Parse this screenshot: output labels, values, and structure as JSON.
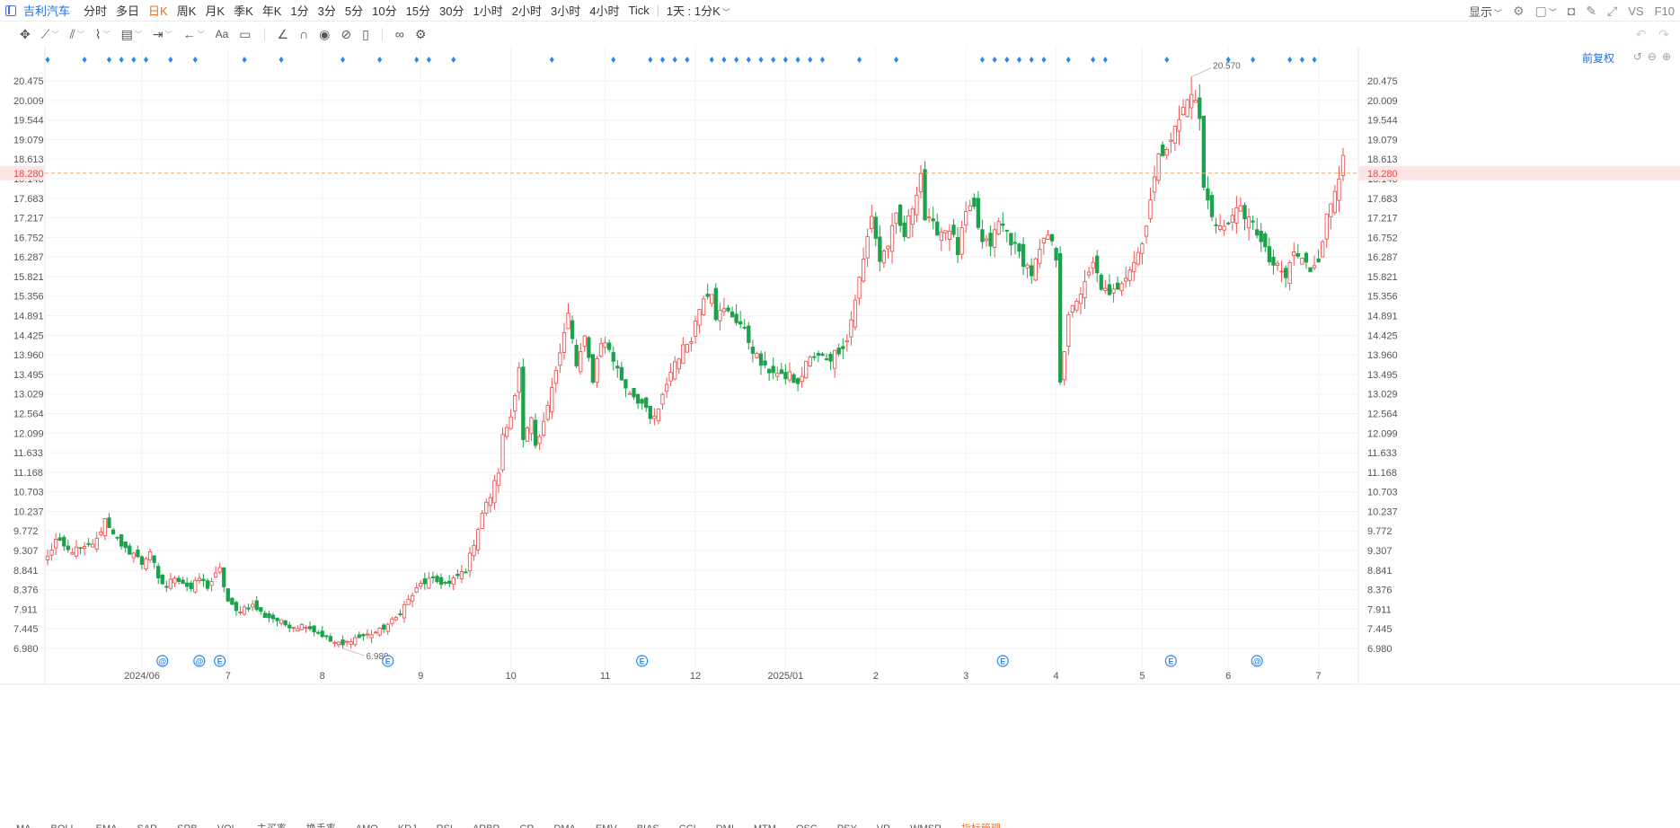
{
  "topbar": {
    "stock_name": "吉利汽车",
    "periods": [
      "分时",
      "多日",
      "日K",
      "周K",
      "月K",
      "季K",
      "年K",
      "1分",
      "3分",
      "5分",
      "10分",
      "15分",
      "30分",
      "1小时",
      "2小时",
      "3小时",
      "4小时",
      "Tick"
    ],
    "active_period": "日K",
    "interval_dropdown": "1天 : 1分K",
    "display_label": "显示",
    "vs_label": "VS",
    "f10_label": "F10"
  },
  "chart_header": {
    "fuquan_label": "前复权"
  },
  "colors": {
    "up": "#f05454",
    "down": "#1aa34a",
    "current_price_line": "#f6a86a",
    "event_marker": "#2b86f0",
    "accent": "#1e6fe8",
    "active_tab": "#f0701e"
  },
  "indicator_strip": {
    "items": [
      "MA",
      "BOLL",
      "EMA",
      "SAR",
      "SRB",
      "VOL",
      "主买率",
      "换手率",
      "AMO",
      "KDJ",
      "RSI",
      "ARBR",
      "CR",
      "DMA",
      "EMV",
      "BIAS",
      "CCI",
      "DMI",
      "MTM",
      "OSC",
      "PSY",
      "VR",
      "WMSR",
      "指标管理"
    ]
  },
  "chart_data": {
    "type": "candlestick",
    "title": "",
    "yaxis_ticks": [
      "20.475",
      "20.009",
      "19.544",
      "19.079",
      "18.613",
      "18.148",
      "17.683",
      "17.217",
      "16.752",
      "16.287",
      "15.821",
      "15.356",
      "14.891",
      "14.425",
      "13.960",
      "13.495",
      "13.029",
      "12.564",
      "12.099",
      "11.633",
      "11.168",
      "10.703",
      "10.237",
      "9.772",
      "9.307",
      "8.841",
      "8.376",
      "7.911",
      "7.445",
      "6.980"
    ],
    "ylim": [
      6.98,
      20.475
    ],
    "current_price": 18.28,
    "current_price_label": "18.280",
    "max_label": "20.570",
    "min_label": "6.980",
    "x_labels": [
      "2024/06",
      "7",
      "8",
      "9",
      "10",
      "11",
      "12",
      "2025/01",
      "2",
      "3",
      "4",
      "5",
      "6",
      "7"
    ],
    "x_label_index": [
      23,
      44,
      67,
      91,
      113,
      136,
      158,
      180,
      202,
      224,
      246,
      267,
      288,
      310
    ],
    "max_index": 279,
    "min_index": 72,
    "events": [
      {
        "index": 28,
        "mark": "@"
      },
      {
        "index": 37,
        "mark": "@"
      },
      {
        "index": 42,
        "mark": "E"
      },
      {
        "index": 83,
        "mark": "E"
      },
      {
        "index": 145,
        "mark": "E"
      },
      {
        "index": 233,
        "mark": "E"
      },
      {
        "index": 274,
        "mark": "E"
      },
      {
        "index": 295,
        "mark": "@"
      }
    ],
    "anchors": [
      [
        0,
        9.15
      ],
      [
        2,
        9.55
      ],
      [
        5,
        9.3
      ],
      [
        9,
        9.35
      ],
      [
        12,
        9.55
      ],
      [
        14,
        10.05
      ],
      [
        16,
        9.75
      ],
      [
        18,
        9.35
      ],
      [
        21,
        9.25
      ],
      [
        23,
        9.0
      ],
      [
        25,
        9.3
      ],
      [
        27,
        8.6
      ],
      [
        29,
        8.45
      ],
      [
        31,
        8.7
      ],
      [
        33,
        8.55
      ],
      [
        35,
        8.4
      ],
      [
        37,
        8.65
      ],
      [
        39,
        8.45
      ],
      [
        42,
        8.85
      ],
      [
        44,
        8.1
      ],
      [
        46,
        7.85
      ],
      [
        48,
        7.95
      ],
      [
        50,
        8.0
      ],
      [
        53,
        7.75
      ],
      [
        55,
        7.7
      ],
      [
        58,
        7.55
      ],
      [
        61,
        7.5
      ],
      [
        63,
        7.55
      ],
      [
        65,
        7.4
      ],
      [
        67,
        7.3
      ],
      [
        69,
        7.15
      ],
      [
        72,
        7.05
      ],
      [
        74,
        7.2
      ],
      [
        76,
        7.25
      ],
      [
        78,
        7.3
      ],
      [
        81,
        7.4
      ],
      [
        83,
        7.55
      ],
      [
        85,
        7.7
      ],
      [
        87,
        8.0
      ],
      [
        89,
        8.25
      ],
      [
        91,
        8.5
      ],
      [
        93,
        8.6
      ],
      [
        96,
        8.55
      ],
      [
        98,
        8.5
      ],
      [
        100,
        8.7
      ],
      [
        102,
        8.85
      ],
      [
        104,
        9.5
      ],
      [
        106,
        10.2
      ],
      [
        108,
        10.6
      ],
      [
        110,
        11.2
      ],
      [
        111,
        12.0
      ],
      [
        113,
        12.5
      ],
      [
        115,
        13.7
      ],
      [
        116,
        11.9
      ],
      [
        118,
        12.4
      ],
      [
        119,
        11.7
      ],
      [
        121,
        12.3
      ],
      [
        123,
        13.3
      ],
      [
        125,
        14.0
      ],
      [
        127,
        14.9
      ],
      [
        129,
        13.7
      ],
      [
        131,
        14.3
      ],
      [
        133,
        13.4
      ],
      [
        135,
        14.3
      ],
      [
        137,
        14.1
      ],
      [
        139,
        13.6
      ],
      [
        141,
        13.2
      ],
      [
        143,
        13.0
      ],
      [
        145,
        12.8
      ],
      [
        147,
        12.4
      ],
      [
        149,
        12.6
      ],
      [
        151,
        13.3
      ],
      [
        153,
        13.8
      ],
      [
        155,
        14.1
      ],
      [
        157,
        14.4
      ],
      [
        160,
        15.4
      ],
      [
        162,
        15.5
      ],
      [
        163,
        14.9
      ],
      [
        165,
        15.0
      ],
      [
        167,
        14.9
      ],
      [
        169,
        14.7
      ],
      [
        171,
        14.3
      ],
      [
        173,
        13.9
      ],
      [
        175,
        13.6
      ],
      [
        177,
        13.6
      ],
      [
        179,
        13.4
      ],
      [
        181,
        13.5
      ],
      [
        183,
        13.2
      ],
      [
        185,
        13.8
      ],
      [
        187,
        13.9
      ],
      [
        189,
        13.9
      ],
      [
        191,
        13.9
      ],
      [
        193,
        14.1
      ],
      [
        195,
        14.3
      ],
      [
        197,
        15.3
      ],
      [
        199,
        16.2
      ],
      [
        201,
        17.3
      ],
      [
        203,
        16.2
      ],
      [
        205,
        16.6
      ],
      [
        207,
        17.2
      ],
      [
        209,
        16.8
      ],
      [
        211,
        17.5
      ],
      [
        213,
        18.3
      ],
      [
        214,
        17.2
      ],
      [
        216,
        17.0
      ],
      [
        218,
        16.9
      ],
      [
        220,
        17.0
      ],
      [
        222,
        16.4
      ],
      [
        224,
        17.3
      ],
      [
        226,
        17.4
      ],
      [
        228,
        16.6
      ],
      [
        230,
        16.6
      ],
      [
        232,
        17.1
      ],
      [
        234,
        16.9
      ],
      [
        236,
        16.5
      ],
      [
        238,
        16.2
      ],
      [
        240,
        15.9
      ],
      [
        242,
        16.4
      ],
      [
        244,
        16.8
      ],
      [
        246,
        16.3
      ],
      [
        247,
        13.4
      ],
      [
        249,
        14.8
      ],
      [
        251,
        15.3
      ],
      [
        253,
        15.6
      ],
      [
        255,
        16.1
      ],
      [
        257,
        15.6
      ],
      [
        259,
        15.3
      ],
      [
        261,
        15.6
      ],
      [
        263,
        15.9
      ],
      [
        265,
        16.2
      ],
      [
        267,
        16.6
      ],
      [
        269,
        17.7
      ],
      [
        271,
        18.6
      ],
      [
        273,
        19.0
      ],
      [
        275,
        19.3
      ],
      [
        277,
        19.8
      ],
      [
        279,
        20.2
      ],
      [
        281,
        19.6
      ],
      [
        282,
        17.9
      ],
      [
        284,
        17.3
      ],
      [
        286,
        17.0
      ],
      [
        288,
        17.0
      ],
      [
        290,
        17.6
      ],
      [
        292,
        17.1
      ],
      [
        294,
        17.2
      ],
      [
        296,
        16.6
      ],
      [
        298,
        16.2
      ],
      [
        300,
        16.0
      ],
      [
        302,
        15.8
      ],
      [
        304,
        16.4
      ],
      [
        306,
        16.2
      ],
      [
        308,
        16.0
      ],
      [
        310,
        16.3
      ],
      [
        312,
        17.2
      ],
      [
        314,
        17.9
      ],
      [
        316,
        18.7
      ]
    ],
    "last_index": 316
  }
}
